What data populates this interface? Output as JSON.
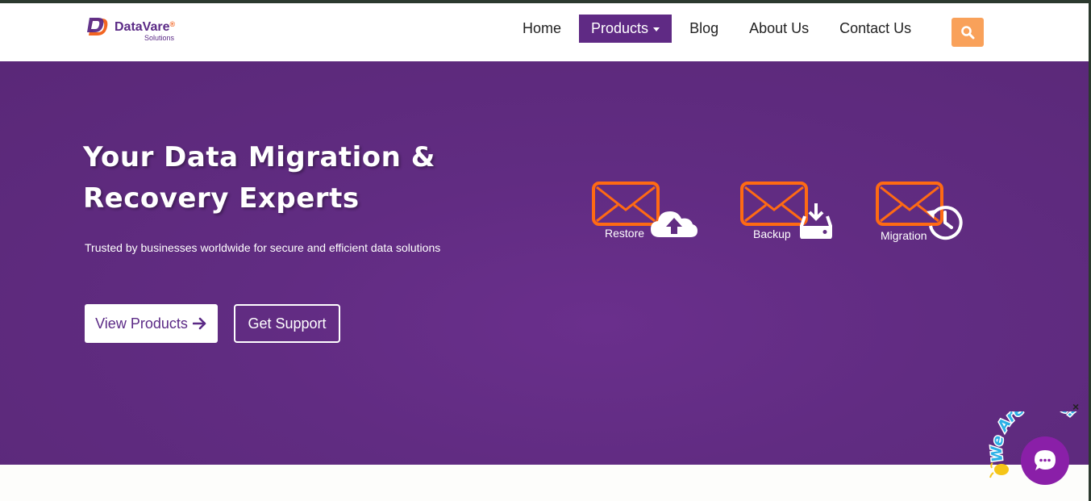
{
  "brand": {
    "name": "DataVare",
    "registered": "®",
    "tagline": "Solutions",
    "colors": {
      "purple": "#5b2a86",
      "orange": "#f26522"
    }
  },
  "nav": {
    "items": [
      {
        "label": "Home",
        "active": false
      },
      {
        "label": "Products",
        "active": true,
        "dropdown": true
      },
      {
        "label": "Blog",
        "active": false
      },
      {
        "label": "About Us",
        "active": false
      },
      {
        "label": "Contact Us",
        "active": false
      }
    ],
    "search_icon": "search-icon",
    "search_color": "#f9a15a"
  },
  "hero": {
    "title_line1": "Your Data Migration &",
    "title_line2": "Recovery Experts",
    "subtitle": "Trusted by businesses worldwide for secure and efficient data solutions",
    "primary_button": "View Products",
    "primary_icon": "arrow-right-icon",
    "secondary_button": "Get Support",
    "background": "#612c82",
    "services": [
      {
        "label": "Restore",
        "icon": "cloud-upload-icon"
      },
      {
        "label": "Backup",
        "icon": "download-drive-icon"
      },
      {
        "label": "Migration",
        "icon": "history-icon"
      }
    ]
  },
  "chat": {
    "badge_text": "We Are Here!",
    "close_label": "×",
    "icon": "chat-bubble-icon",
    "color": "#8a1fa8"
  }
}
